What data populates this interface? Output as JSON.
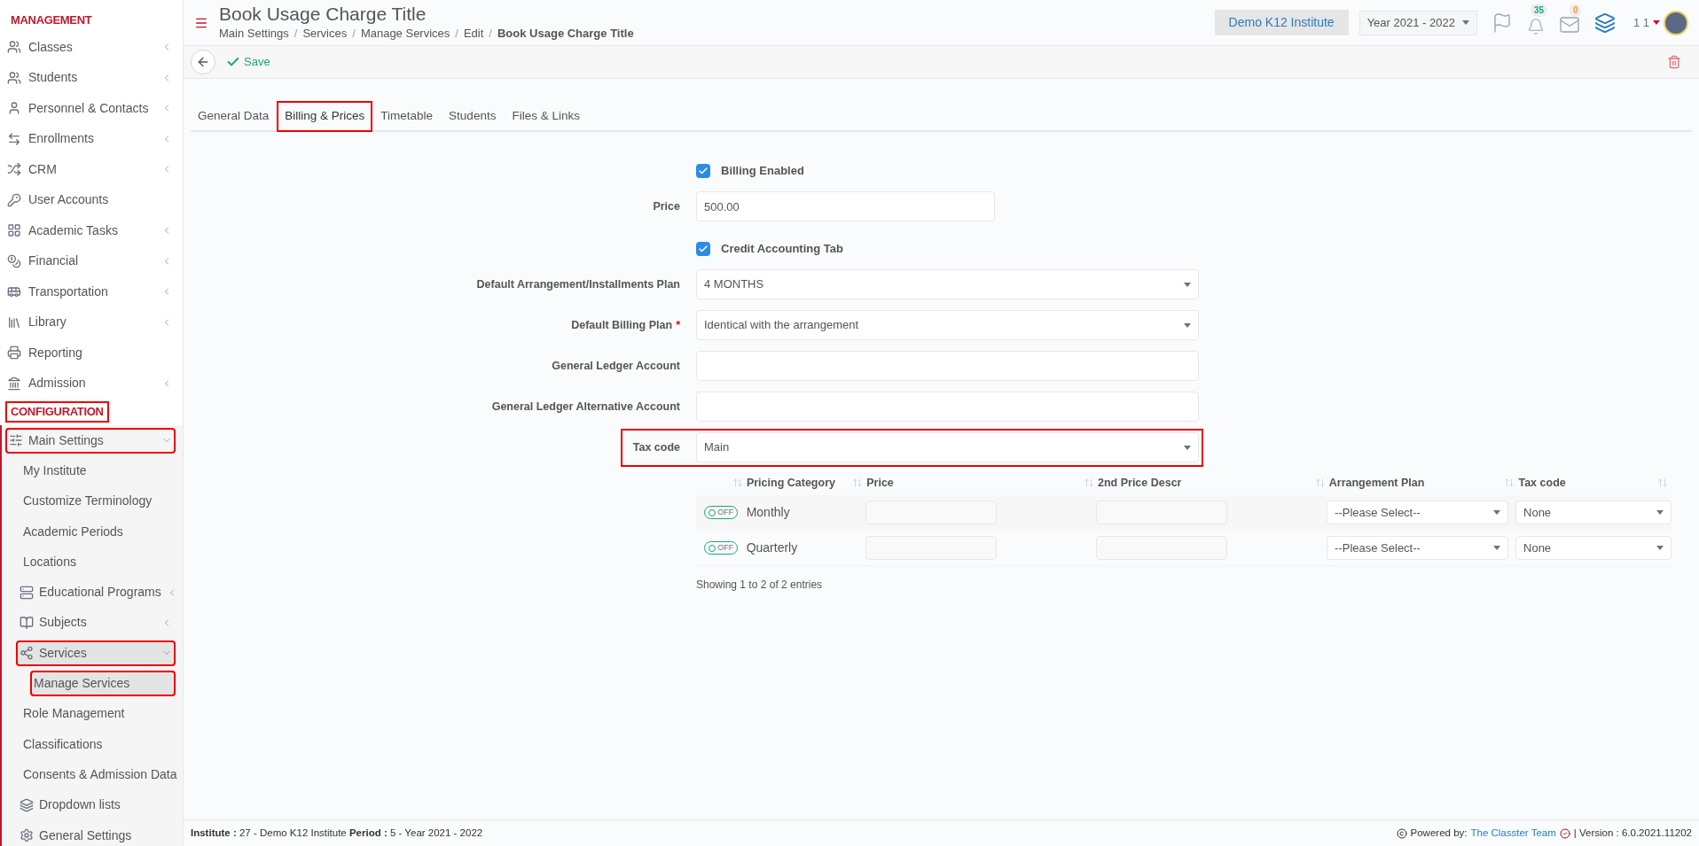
{
  "sidebar": {
    "sections": [
      {
        "title": "MANAGEMENT",
        "highlighted": false,
        "items": [
          {
            "label": "Classes",
            "kind": "submenu",
            "expanded": false,
            "selected": false,
            "highlighted": false
          },
          {
            "label": "Students",
            "kind": "submenu",
            "expanded": false,
            "selected": false,
            "highlighted": false
          },
          {
            "label": "Personnel & Contacts",
            "kind": "submenu",
            "expanded": false,
            "selected": false,
            "highlighted": false
          },
          {
            "label": "Enrollments",
            "kind": "submenu",
            "expanded": false,
            "selected": false,
            "highlighted": false
          },
          {
            "label": "CRM",
            "kind": "submenu",
            "expanded": false,
            "selected": false,
            "highlighted": false
          },
          {
            "label": "User Accounts",
            "kind": "link",
            "selected": false,
            "highlighted": false
          },
          {
            "label": "Academic Tasks",
            "kind": "submenu",
            "expanded": false,
            "selected": false,
            "highlighted": false
          },
          {
            "label": "Financial",
            "kind": "submenu",
            "expanded": false,
            "selected": false,
            "highlighted": false
          },
          {
            "label": "Transportation",
            "kind": "submenu",
            "expanded": false,
            "selected": false,
            "highlighted": false
          },
          {
            "label": "Library",
            "kind": "submenu",
            "expanded": false,
            "selected": false,
            "highlighted": false
          },
          {
            "label": "Reporting",
            "kind": "link",
            "selected": false,
            "highlighted": false
          },
          {
            "label": "Admission",
            "kind": "submenu",
            "expanded": false,
            "selected": false,
            "highlighted": false
          }
        ]
      },
      {
        "title": "CONFIGURATION",
        "highlighted": true,
        "items": [
          {
            "label": "Main Settings",
            "kind": "submenu",
            "expanded": true,
            "selected": false,
            "highlighted": true,
            "children": [
              {
                "label": "My Institute",
                "kind": "link",
                "selected": false,
                "highlighted": false
              },
              {
                "label": "Customize Terminology",
                "kind": "link",
                "selected": false,
                "highlighted": false
              },
              {
                "label": "Academic Periods",
                "kind": "link",
                "selected": false,
                "highlighted": false
              },
              {
                "label": "Locations",
                "kind": "link",
                "selected": false,
                "highlighted": false
              },
              {
                "label": "Educational Programs",
                "kind": "submenu",
                "expanded": false,
                "selected": false,
                "highlighted": false
              },
              {
                "label": "Subjects",
                "kind": "submenu",
                "expanded": false,
                "selected": false,
                "highlighted": false
              },
              {
                "label": "Services",
                "kind": "submenu",
                "expanded": true,
                "selected": true,
                "highlighted": true,
                "children": [
                  {
                    "label": "Manage Services",
                    "selected": true,
                    "highlighted": true
                  }
                ]
              },
              {
                "label": "Role Management",
                "kind": "link",
                "selected": false,
                "highlighted": false
              },
              {
                "label": "Classifications",
                "kind": "link",
                "selected": false,
                "highlighted": false
              },
              {
                "label": "Consents & Admission Data",
                "kind": "link",
                "selected": false,
                "highlighted": false
              },
              {
                "label": "Dropdown lists",
                "kind": "link",
                "selected": false,
                "highlighted": false
              },
              {
                "label": "General Settings",
                "kind": "link",
                "selected": false,
                "highlighted": false
              }
            ]
          }
        ]
      }
    ]
  },
  "header": {
    "title": "Book Usage Charge Title",
    "breadcrumbs": [
      {
        "label": "Main Settings",
        "separator": "/"
      },
      {
        "label": "Services",
        "separator": "/"
      },
      {
        "label": "Manage Services",
        "separator": "/"
      },
      {
        "label": "Edit",
        "separator": "/"
      },
      {
        "label": "Book Usage Charge Title"
      }
    ],
    "institute": "Demo K12 Institute",
    "year": "Year 2021 - 2022",
    "notifications": "35",
    "messages": "0",
    "user": "1 1"
  },
  "toolbar": {
    "save": "Save"
  },
  "tabs": [
    {
      "label": "General Data",
      "selected": false,
      "highlighted": false
    },
    {
      "label": "Billing & Prices",
      "selected": true,
      "highlighted": true
    },
    {
      "label": "Timetable",
      "selected": false,
      "highlighted": false
    },
    {
      "label": "Students",
      "selected": false,
      "highlighted": false
    },
    {
      "label": "Files & Links",
      "selected": false,
      "highlighted": false
    }
  ],
  "form": [
    {
      "kind": "checkbox",
      "label": "Billing Enabled",
      "checked": true,
      "highlighted": false
    },
    {
      "kind": "input",
      "label": "Price",
      "value": "500.00",
      "highlighted": false
    },
    {
      "kind": "checkbox",
      "label": "Credit Accounting Tab",
      "checked": true,
      "highlighted": false
    },
    {
      "kind": "select",
      "label": "Default Arrangement/Installments Plan",
      "value": "4 MONTHS",
      "highlighted": false
    },
    {
      "kind": "select",
      "label": "Default Billing Plan",
      "required_mark": "*",
      "value": "Identical with the arrangement",
      "highlighted": false
    },
    {
      "kind": "input",
      "label": "General Ledger Account",
      "highlighted": false
    },
    {
      "kind": "input",
      "label": "General Ledger Alternative Account",
      "highlighted": false
    },
    {
      "kind": "select",
      "label": "Tax code",
      "value": "Main",
      "highlighted": true
    }
  ],
  "table": {
    "columns": [
      "Pricing Category",
      "Price",
      "2nd Price Descr",
      "Arrangement Plan",
      "Tax code"
    ],
    "rows": [
      {
        "on": false,
        "toggle": "OFF",
        "category": "Monthly",
        "arrangement": "--Please Select--",
        "tax": "None"
      },
      {
        "on": false,
        "toggle": "OFF",
        "category": "Quarterly",
        "arrangement": "--Please Select--",
        "tax": "None"
      }
    ],
    "info": "Showing 1 to 2 of 2 entries"
  },
  "footer": {
    "info": "**Institute :** 27 - Demo K12 Institute **Period :** 5 - Year 2021 - 2022",
    "powered": "Powered by:",
    "team": "The Classter Team",
    "version": "| Version : 6.0.2021.11202"
  }
}
